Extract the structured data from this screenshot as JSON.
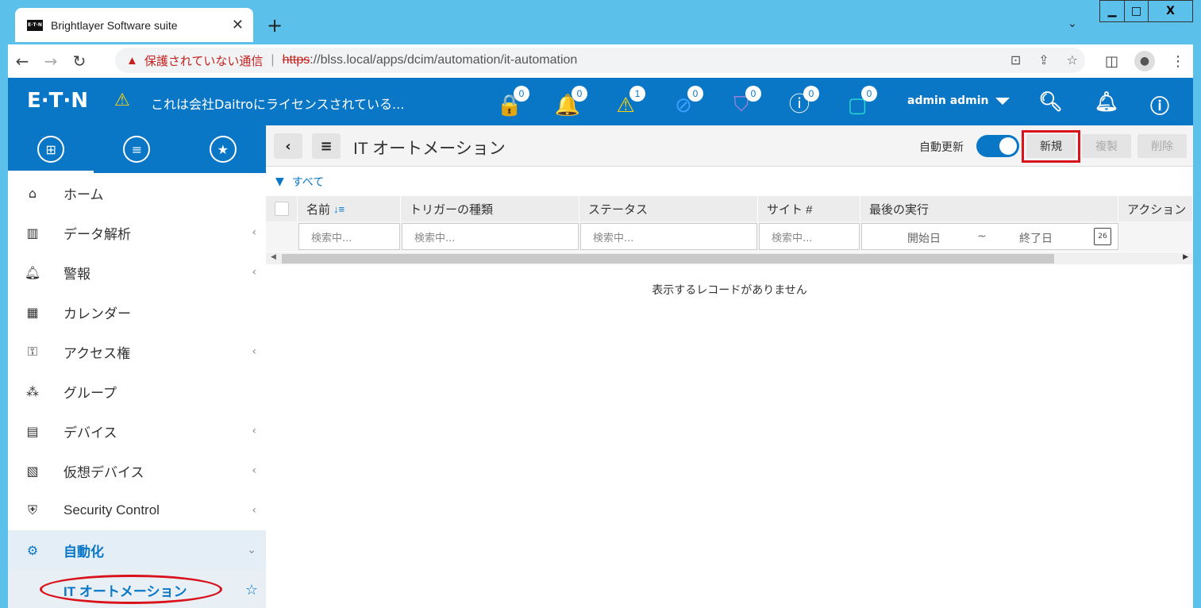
{
  "browser": {
    "tab_title": "Brightlayer Software suite",
    "new_tab": "+",
    "tab_close": "✕",
    "tablist_chevron": "⌄",
    "window_minimize": "▁",
    "window_maximize": "□",
    "window_close": "X",
    "security_warning": "保護されていない通信",
    "url_scheme": "https",
    "url_rest": "://blss.local/apps/dcim/automation/it-automation"
  },
  "header": {
    "logo": "E·T·N",
    "license_text": "これは会社Daitroにライセンスされている...",
    "alert_badges": [
      "0",
      "0",
      "1",
      "0",
      "0",
      "0",
      "0"
    ],
    "user_name": "admin admin"
  },
  "sidebar": {
    "items": [
      {
        "label": "ホーム",
        "icon": "home-icon",
        "has_chevron": false
      },
      {
        "label": "データ解析",
        "icon": "chart-icon",
        "has_chevron": true
      },
      {
        "label": "警報",
        "icon": "alarm-icon",
        "has_chevron": true
      },
      {
        "label": "カレンダー",
        "icon": "calendar-icon",
        "has_chevron": false
      },
      {
        "label": "アクセス権",
        "icon": "access-key-icon",
        "has_chevron": true
      },
      {
        "label": "グループ",
        "icon": "group-icon",
        "has_chevron": false
      },
      {
        "label": "デバイス",
        "icon": "device-icon",
        "has_chevron": true
      },
      {
        "label": "仮想デバイス",
        "icon": "virtual-device-icon",
        "has_chevron": true
      },
      {
        "label": "Security Control",
        "icon": "shield-icon",
        "has_chevron": true
      },
      {
        "label": "自動化",
        "icon": "automation-gear-icon",
        "has_chevron": true,
        "expanded": true
      }
    ],
    "sub_item": "IT オートメーション"
  },
  "main": {
    "title": "IT オートメーション",
    "auto_refresh_label": "自動更新",
    "auto_refresh_on": true,
    "new_button": "新規",
    "duplicate_button": "複製",
    "delete_button": "削除",
    "filter_text": "すべて",
    "columns": [
      "名前",
      "トリガーの種類",
      "ステータス",
      "サイト #",
      "最後の実行",
      "アクション"
    ],
    "search_placeholder": "検索中...",
    "date_start": "開始日",
    "date_sep": "~",
    "date_end": "終了日",
    "calendar_day": "26",
    "empty_message": "表示するレコードがありません"
  },
  "colors": {
    "brand_blue": "#0a77c6",
    "highlight_red": "#d9121c",
    "chrome_blue": "#5bc1ea"
  }
}
